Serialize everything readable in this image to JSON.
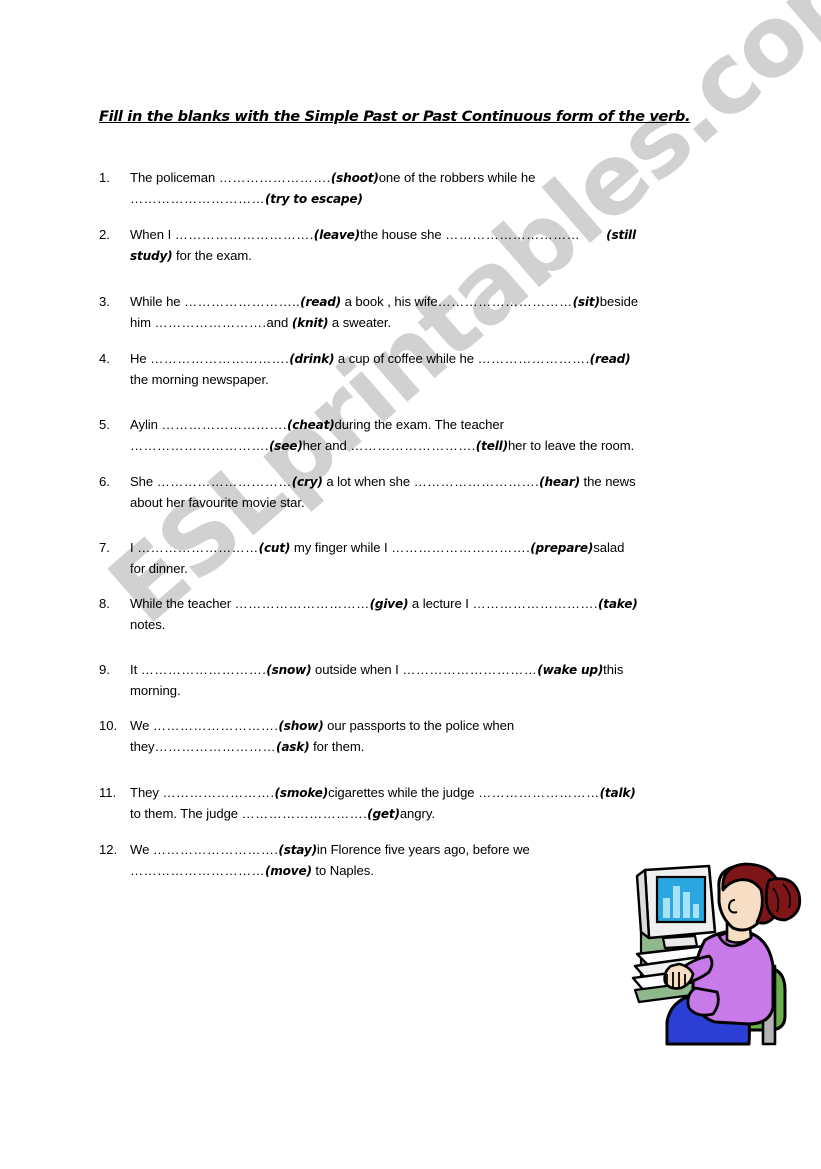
{
  "worksheet": {
    "title": "Fill in the blanks with the Simple Past or Past Continuous form of the verb.",
    "watermark": "ESLprintables.com",
    "items": [
      {
        "number": "1.",
        "line1_a": "The policeman ",
        "line1_dots": "…………………….",
        "line1_cue": "(shoot)",
        "line1_b": "one of the robbers while he",
        "line2_dots": "…………………………",
        "line2_cue": "(try to escape)",
        "line2_b": ""
      },
      {
        "number": "2.",
        "line1_a": "When I ",
        "line1_dots": "………………………….",
        "line1_cue": "(leave)",
        "line1_b": "the house she ",
        "line1_dots2": "…………………………",
        "line1_cue2": "(still",
        "line2_cue": "study)",
        "line2_b": " for the exam."
      },
      {
        "number": "3.",
        "line1_a": "While he ",
        "line1_dots": "……………………..",
        "line1_cue": "(read)",
        "line1_b": " a book , his wife",
        "line1_dots2": "…………………………",
        "line1_cue2": "(sit)",
        "line1_c": "beside",
        "line2_a": "him ",
        "line2_dots": "…………………….",
        "line2_b": "and ",
        "line2_cue": "(knit)",
        "line2_c": " a sweater."
      },
      {
        "number": "4.",
        "line1_a": "He ",
        "line1_dots": "………………………….",
        "line1_cue": "(drink)",
        "line1_b": " a cup of coffee while he ",
        "line1_dots2": "…………………….",
        "line1_cue2": "(read)",
        "line2_b": "the morning newspaper."
      },
      {
        "number": "5.",
        "line1_a": "Aylin ",
        "line1_dots": "……………………….",
        "line1_cue": "(cheat)",
        "line1_b": "during the exam. The teacher",
        "line2_dots": "………………………….",
        "line2_cue": "(see)",
        "line2_b": "her and ",
        "line2_dots2": "……………………….",
        "line2_cue2": "(tell)",
        "line2_c": "her to leave the room."
      },
      {
        "number": "6.",
        "line1_a": "She ",
        "line1_dots": "…………………………",
        "line1_cue": "(cry)",
        "line1_b": " a lot when she ",
        "line1_dots2": "……………………….",
        "line1_cue2": "(hear)",
        "line1_c": " the news",
        "line2_b": "about her favourite movie star."
      },
      {
        "number": "7.",
        "line1_a": "I ",
        "line1_dots": "………………………",
        "line1_cue": "(cut)",
        "line1_b": " my finger while I ",
        "line1_dots2": "………………………….",
        "line1_cue2": "(prepare)",
        "line1_c": "salad",
        "line2_b": "for dinner."
      },
      {
        "number": "8.",
        "line1_a": "While the teacher ",
        "line1_dots": "…………………………",
        "line1_cue": "(give)",
        "line1_b": " a lecture I ",
        "line1_dots2": "……………………….",
        "line1_cue2": "(take)",
        "line2_b": "notes."
      },
      {
        "number": "9.",
        "line1_a": "It ",
        "line1_dots": "……………………….",
        "line1_cue": "(snow)",
        "line1_b": " outside when I ",
        "line1_dots2": "…………………………",
        "line1_cue2": "(wake up)",
        "line1_c": "this",
        "line2_b": "morning."
      },
      {
        "number": "10.",
        "line1_a": "We ",
        "line1_dots": "……………………….",
        "line1_cue": "(show)",
        "line1_b": " our passports to the police when",
        "line2_a": "they",
        "line2_dots": "………………………",
        "line2_cue": "(ask)",
        "line2_b": " for them."
      },
      {
        "number": "11.",
        "line1_a": "They ",
        "line1_dots": "…………………….",
        "line1_cue": "(smoke)",
        "line1_b": "cigarettes while the judge ",
        "line1_dots2": "………………………",
        "line1_cue2": "(talk)",
        "line2_a": "to them. The judge ",
        "line2_dots": "……………………….",
        "line2_cue": "(get)",
        "line2_b": "angry."
      },
      {
        "number": "12.",
        "line1_a": "We ",
        "line1_dots": "……………………….",
        "line1_cue": "(stay)",
        "line1_b": "in Florence five years ago, before we",
        "line2_dots": "…………………………",
        "line2_cue": "(move)",
        "line2_b": " to Naples."
      }
    ]
  },
  "clipart": {
    "name": "woman-at-computer",
    "colors": {
      "hair": "#7d1519",
      "skin": "#f7ddc3",
      "shirt": "#c77ae8",
      "skirt": "#2b3fd4",
      "chair": "#6ab04c",
      "monitor_body": "#e6e6e6",
      "monitor_shadow": "#a9c7a4",
      "screen": "#2aa7e0",
      "screen_bars": "#9fdcf5",
      "outline": "#000000"
    }
  }
}
